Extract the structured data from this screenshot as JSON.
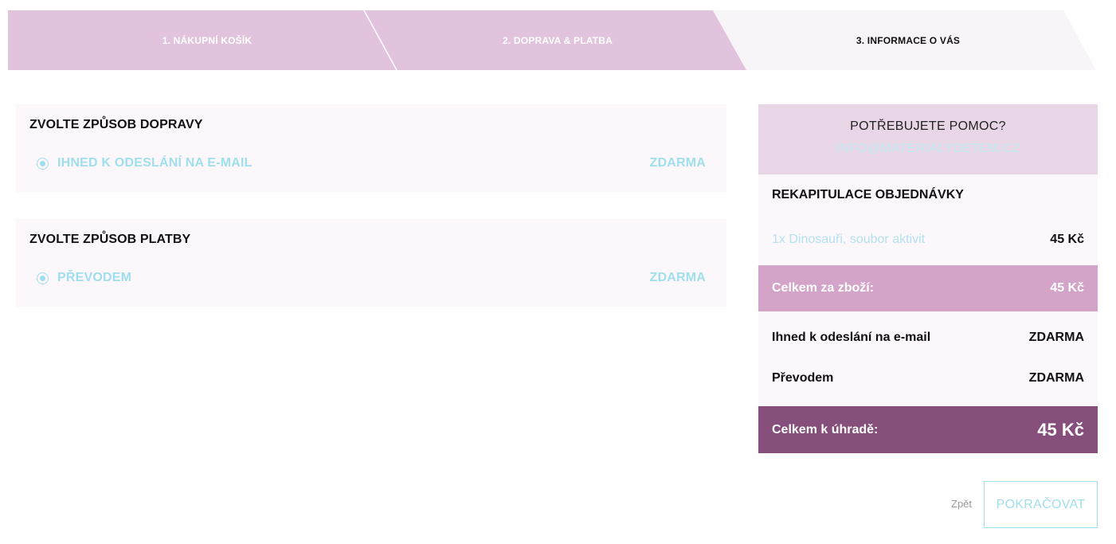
{
  "steps": [
    {
      "label": "1. NÁKUPNÍ KOŠÍK",
      "state": "done"
    },
    {
      "label": "2. DOPRAVA & PLATBA",
      "state": "done"
    },
    {
      "label": "3. INFORMACE O VÁS",
      "state": "current"
    }
  ],
  "shipping": {
    "title": "ZVOLTE ZPŮSOB DOPRAVY",
    "option_label": "IHNED K ODESLÁNÍ NA E-MAIL",
    "option_price": "ZDARMA"
  },
  "payment": {
    "title": "ZVOLTE ZPŮSOB PLATBY",
    "option_label": "PŘEVODEM",
    "option_price": "ZDARMA"
  },
  "help": {
    "title": "POTŘEBUJETE POMOC?",
    "email": "INFO@MATERIALYDETEM.CZ"
  },
  "recap": {
    "title": "REKAPITULACE OBJEDNÁVKY",
    "item_name": "1x Dinosauři, soubor aktivit",
    "item_price": "45 Kč",
    "subtotal_label": "Celkem za zboží:",
    "subtotal_value": "45 Kč",
    "fees": [
      {
        "label": "Ihned k odeslání na e-mail",
        "value": "ZDARMA"
      },
      {
        "label": "Převodem",
        "value": "ZDARMA"
      }
    ],
    "total_label": "Celkem k úhradě:",
    "total_value": "45 Kč"
  },
  "actions": {
    "back_label": "Zpět",
    "continue_label": "POKRAČOVAT"
  },
  "colors": {
    "step_done": "#e2c3dd",
    "step_current": "#f8f5f8",
    "accent_cyan": "#9fdfec",
    "subtotal_bg": "#d4a4c8",
    "total_bg": "#864f7b",
    "help_bg": "#e8d6e6"
  }
}
